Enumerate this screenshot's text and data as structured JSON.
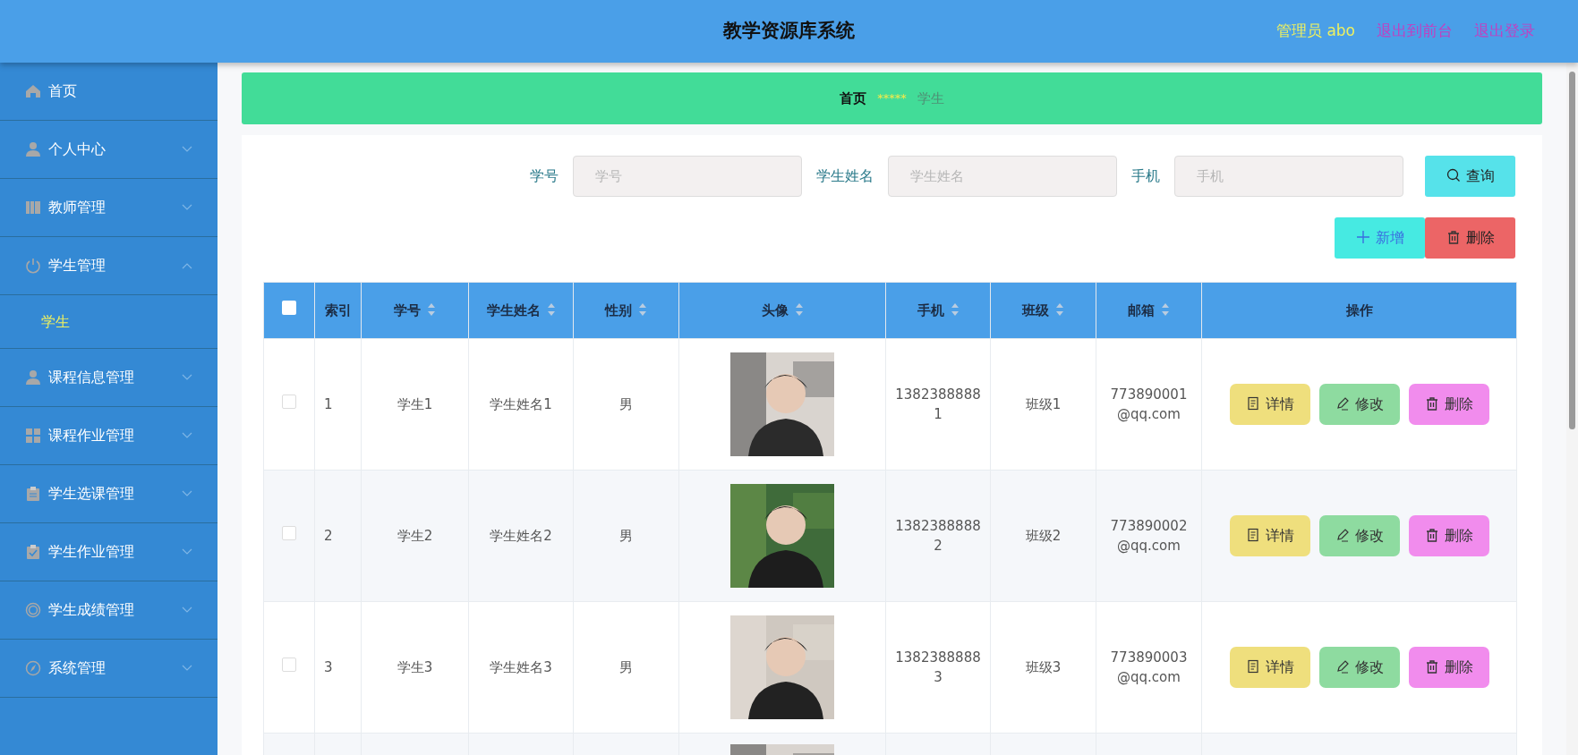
{
  "header": {
    "title": "教学资源库系统",
    "user": "管理员 abo",
    "links": [
      "退出到前台",
      "退出登录"
    ]
  },
  "sidebar": {
    "items": [
      {
        "label": "首页",
        "kind": "link"
      },
      {
        "label": "个人中心",
        "kind": "menu",
        "expanded": false
      },
      {
        "label": "教师管理",
        "kind": "menu",
        "expanded": false
      },
      {
        "label": "学生管理",
        "kind": "menu",
        "expanded": true,
        "children": [
          {
            "label": "学生",
            "selected": true
          }
        ]
      },
      {
        "label": "课程信息管理",
        "kind": "menu",
        "expanded": false
      },
      {
        "label": "课程作业管理",
        "kind": "menu",
        "expanded": false
      },
      {
        "label": "学生选课管理",
        "kind": "menu",
        "expanded": false
      },
      {
        "label": "学生作业管理",
        "kind": "menu",
        "expanded": false
      },
      {
        "label": "学生成绩管理",
        "kind": "menu",
        "expanded": false
      },
      {
        "label": "系统管理",
        "kind": "menu",
        "expanded": false
      }
    ]
  },
  "breadcrumb": {
    "home": "首页",
    "separator": "*****",
    "current": "学生"
  },
  "search": {
    "fields": [
      {
        "label": "学号",
        "placeholder": "学号"
      },
      {
        "label": "学生姓名",
        "placeholder": "学生姓名"
      },
      {
        "label": "手机",
        "placeholder": "手机"
      }
    ],
    "button": "查询"
  },
  "actions": [
    {
      "label": "新增",
      "kind": "add"
    },
    {
      "label": "删除",
      "kind": "delete"
    }
  ],
  "table": {
    "select_all": {
      "checked": false
    },
    "columns": [
      {
        "label": "索引",
        "sortable": false
      },
      {
        "label": "学号",
        "sortable": true
      },
      {
        "label": "学生姓名",
        "sortable": true
      },
      {
        "label": "性别",
        "sortable": true
      },
      {
        "label": "头像",
        "sortable": true
      },
      {
        "label": "手机",
        "sortable": true
      },
      {
        "label": "班级",
        "sortable": true
      },
      {
        "label": "邮箱",
        "sortable": true
      },
      {
        "label": "操作",
        "sortable": false
      }
    ],
    "rows": [
      {
        "kind": "full",
        "checked": false,
        "index": "1",
        "student_no": "学生1",
        "name": "学生姓名1",
        "gender": "男",
        "avatar": {
          "kind": "picture"
        },
        "phone": "13823888881",
        "class": "班级1",
        "email": "773890001@qq.com",
        "buttons": [
          {
            "label": "详情",
            "kind": "detail"
          },
          {
            "label": "修改",
            "kind": "edit"
          },
          {
            "label": "删除",
            "kind": "delete"
          }
        ]
      },
      {
        "kind": "full",
        "checked": false,
        "index": "2",
        "student_no": "学生2",
        "name": "学生姓名2",
        "gender": "男",
        "avatar": {
          "kind": "picture"
        },
        "phone": "13823888882",
        "class": "班级2",
        "email": "773890002@qq.com",
        "buttons": [
          {
            "label": "详情",
            "kind": "detail"
          },
          {
            "label": "修改",
            "kind": "edit"
          },
          {
            "label": "删除",
            "kind": "delete"
          }
        ]
      },
      {
        "kind": "full",
        "checked": false,
        "index": "3",
        "student_no": "学生3",
        "name": "学生姓名3",
        "gender": "男",
        "avatar": {
          "kind": "picture"
        },
        "phone": "13823888883",
        "class": "班级3",
        "email": "773890003@qq.com",
        "buttons": [
          {
            "label": "详情",
            "kind": "detail"
          },
          {
            "label": "修改",
            "kind": "edit"
          },
          {
            "label": "删除",
            "kind": "delete"
          }
        ]
      },
      {
        "kind": "cut",
        "avatar": {
          "kind": "picture"
        }
      }
    ]
  }
}
